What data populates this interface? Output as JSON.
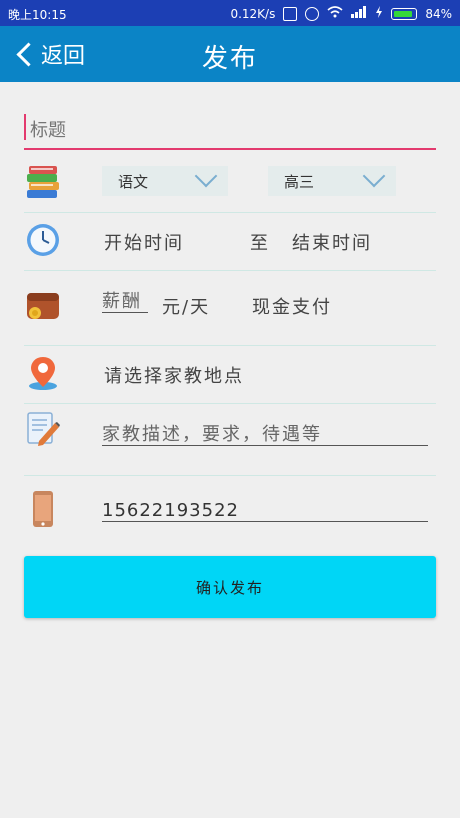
{
  "status_bar": {
    "time": "晚上10:15",
    "speed": "0.12K/s",
    "battery": "84%"
  },
  "header": {
    "back_label": "返回",
    "title": "发布"
  },
  "form": {
    "title_placeholder": "标题",
    "subject_select": "语文",
    "grade_select": "高三",
    "start_time": "开始时间",
    "to_label": "至",
    "end_time": "结束时间",
    "salary_placeholder": "薪酬",
    "salary_unit": "元/天",
    "payment_method": "现金支付",
    "location_prompt": "请选择家教地点",
    "description_placeholder": "家教描述，要求，待遇等",
    "phone_value": "15622193522"
  },
  "confirm_label": "确认发布",
  "colors": {
    "status_bar": "#1c3fb4",
    "app_bar": "#0b84c6",
    "accent_underline": "#e33a6e",
    "confirm_button": "#00d6f6",
    "background": "#efefef"
  }
}
